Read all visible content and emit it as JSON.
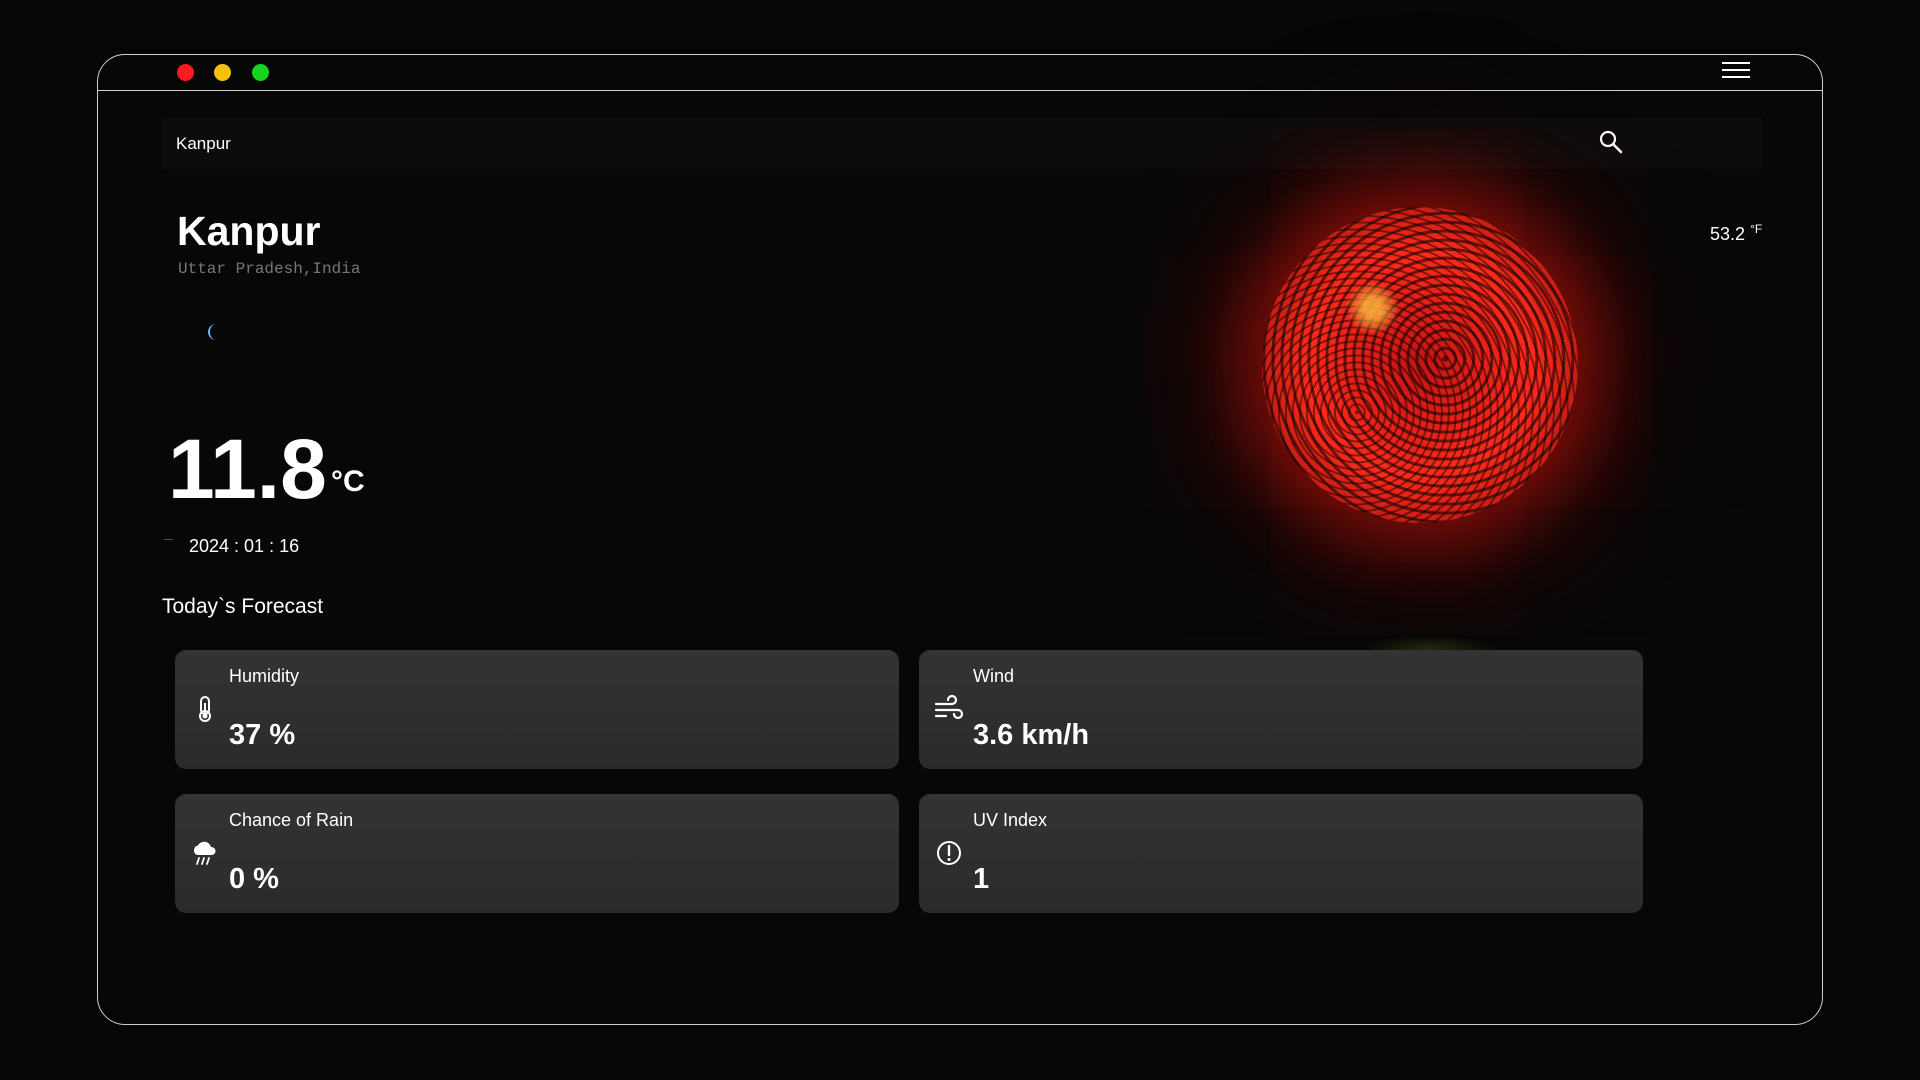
{
  "window": {
    "controls": [
      "close",
      "minimize",
      "maximize"
    ],
    "menu_icon": "hamburger-icon"
  },
  "search": {
    "value": "Kanpur",
    "icon": "search-icon"
  },
  "location": {
    "city": "Kanpur",
    "region": "Uttar Pradesh,India"
  },
  "current": {
    "condition_icon": "moon-icon",
    "temp_c": "11.8",
    "temp_c_unit": "°C",
    "temp_f": "53.2",
    "temp_f_unit": "°F",
    "date": "2024 : 01 : 16"
  },
  "forecast": {
    "title": "Today`s Forecast",
    "cards": [
      {
        "label": "Humidity",
        "value": "37 %",
        "icon": "thermometer-icon"
      },
      {
        "label": "Wind",
        "value": "3.6 km/h",
        "icon": "wind-icon"
      },
      {
        "label": "Chance of Rain",
        "value": "0 %",
        "icon": "rain-cloud-icon"
      },
      {
        "label": "UV Index",
        "value": "1",
        "icon": "alert-circle-icon"
      }
    ]
  },
  "colors": {
    "background": "#060606",
    "card": "#2f2f2f",
    "sun": "#ff2a1a",
    "dot_red": "#ff1b1b",
    "dot_yellow": "#f4c20d",
    "dot_green": "#16d41a"
  }
}
